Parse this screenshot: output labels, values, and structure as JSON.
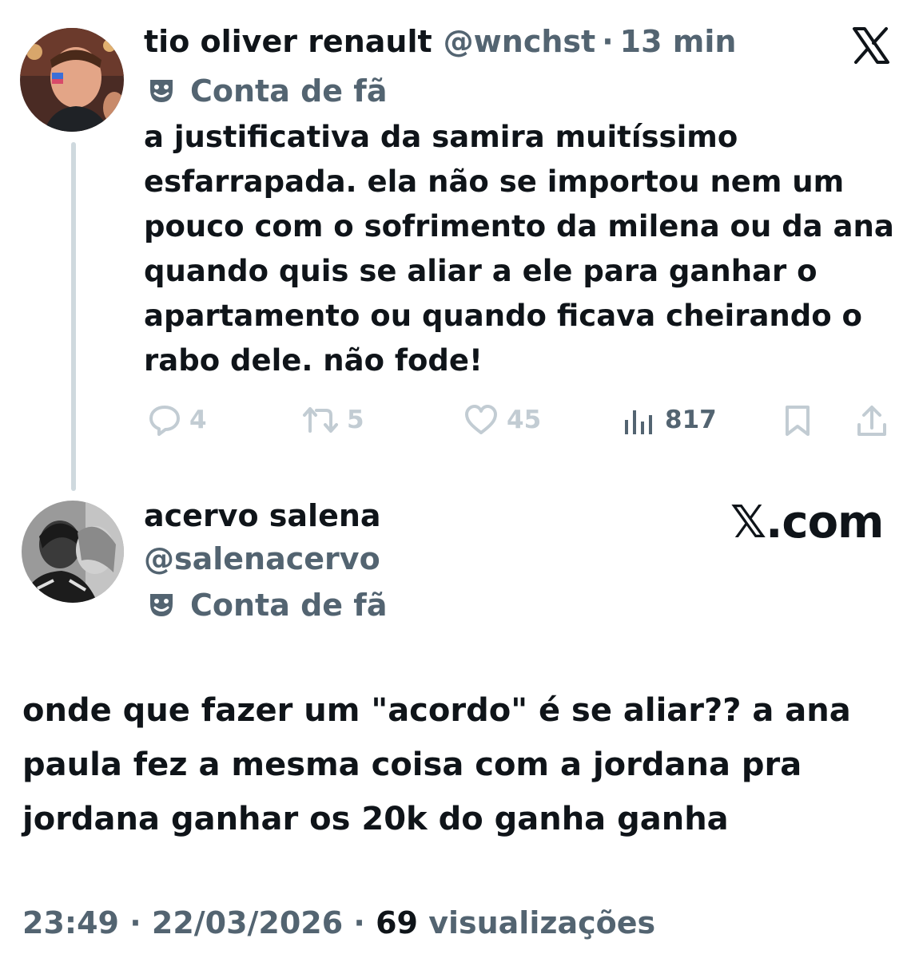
{
  "first_tweet": {
    "author_name": "tio oliver renault",
    "handle": "@wnchst",
    "separator": "·",
    "time_ago": "13 min",
    "badge_label": "Conta de fã",
    "text": "a justificativa da samira muitíssimo esfarrapada. ela não se importou nem um pouco com o sofrimento da milena ou da ana quando quis se aliar a ele para ganhar o apartamento ou quando ficava cheirando o rabo dele. não fode!",
    "metrics": {
      "replies": "4",
      "reposts": "5",
      "likes": "45",
      "views": "817"
    }
  },
  "second_tweet": {
    "author_name": "acervo salena",
    "handle": "@salenacervo",
    "badge_label": "Conta de fã",
    "brand": "𝕏.com",
    "text": "onde que fazer um \"acordo\" é se aliar?? a ana paula fez a mesma coisa com a jordana pra jordana ganhar os 20k do ganha ganha",
    "footer": {
      "time": "23:49",
      "sep1": "·",
      "date": "22/03/2026",
      "sep2": "·",
      "views_count": "69",
      "views_label": "visualizações"
    }
  },
  "icons": {
    "close": "x-logo-icon",
    "badge": "theater-masks-icon",
    "reply": "reply-icon",
    "repost": "repost-icon",
    "like": "heart-icon",
    "views": "views-bar-icon",
    "bookmark": "bookmark-icon",
    "share": "share-icon"
  },
  "colors": {
    "text": "#0f1419",
    "muted": "#536471",
    "action_gray": "#c2ccd3",
    "thread_line": "#cfd9de"
  }
}
